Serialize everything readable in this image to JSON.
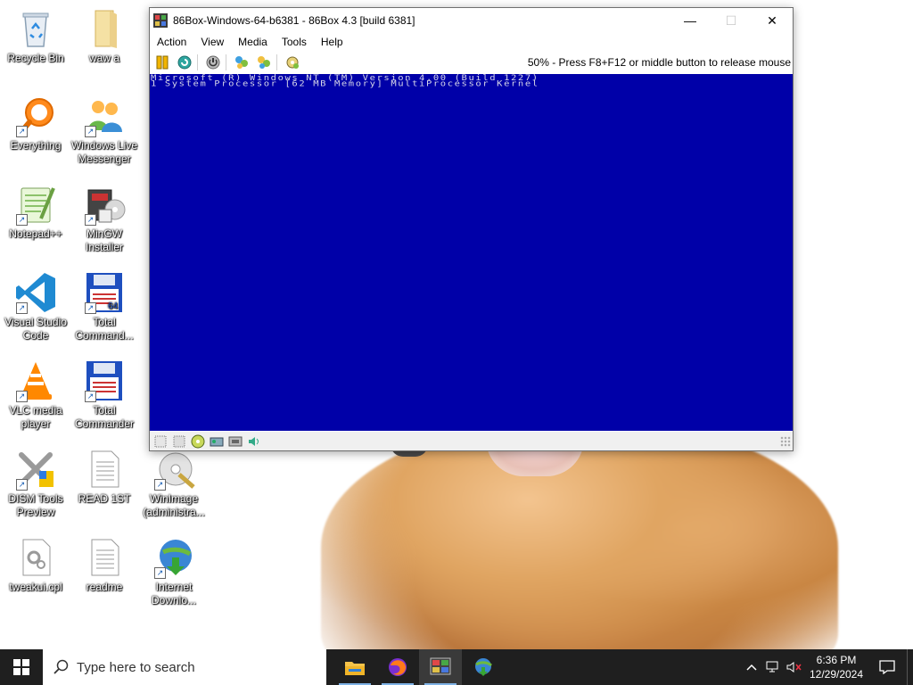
{
  "desktop": {
    "icons": [
      {
        "name": "recycle-bin-icon",
        "label": "Recycle Bin"
      },
      {
        "name": "folder-icon",
        "label": "waw a"
      },
      {
        "name": "everything-icon",
        "label": "Everything"
      },
      {
        "name": "windows-live-messenger-icon",
        "label": "Windows Live Messenger"
      },
      {
        "name": "notepad-plus-plus-icon",
        "label": "Notepad++"
      },
      {
        "name": "mingw-installer-icon",
        "label": "MinGW Installer"
      },
      {
        "name": "vscode-icon",
        "label": "Visual Studio Code"
      },
      {
        "name": "total-commander-64-icon",
        "label": "Total Command..."
      },
      {
        "name": "vlc-icon",
        "label": "VLC media player"
      },
      {
        "name": "total-commander-icon",
        "label": "Total Commander"
      },
      {
        "name": "dism-tools-icon",
        "label": "DISM Tools Preview"
      },
      {
        "name": "text-document-icon",
        "label": "READ 1ST"
      },
      {
        "name": "winimage-icon",
        "label": "WinImage (administra..."
      },
      {
        "name": "cpl-file-icon",
        "label": "tweakui.cpl"
      },
      {
        "name": "text-document-icon",
        "label": "readme"
      },
      {
        "name": "internet-download-manager-icon",
        "label": "Internet Downlo..."
      }
    ]
  },
  "window": {
    "title": "86Box-Windows-64-b6381 - 86Box 4.3 [build 6381]",
    "controls": {
      "minimize": "—",
      "maximize": "☐",
      "close": "✕"
    },
    "menu": [
      "Action",
      "View",
      "Media",
      "Tools",
      "Help"
    ],
    "toolbar_status": "50% - Press F8+F12 or middle button to release mouse",
    "screen_lines": [
      "Microsoft (R) Windows NT (TM) Version 4.00 (Build 1227)",
      "1 System Processor [62 MB Memory] MultiProcessor Kernel"
    ],
    "colors": {
      "screen_bg": "#0000a8",
      "screen_text": "#d7d7e8"
    }
  },
  "taskbar": {
    "search_placeholder": "Type here to search",
    "apps": [
      "file-explorer-icon",
      "firefox-icon",
      "86box-icon",
      "internet-download-manager-icon"
    ],
    "active_app": "86box-icon",
    "clock_time": "6:36 PM",
    "clock_date": "12/29/2024"
  }
}
